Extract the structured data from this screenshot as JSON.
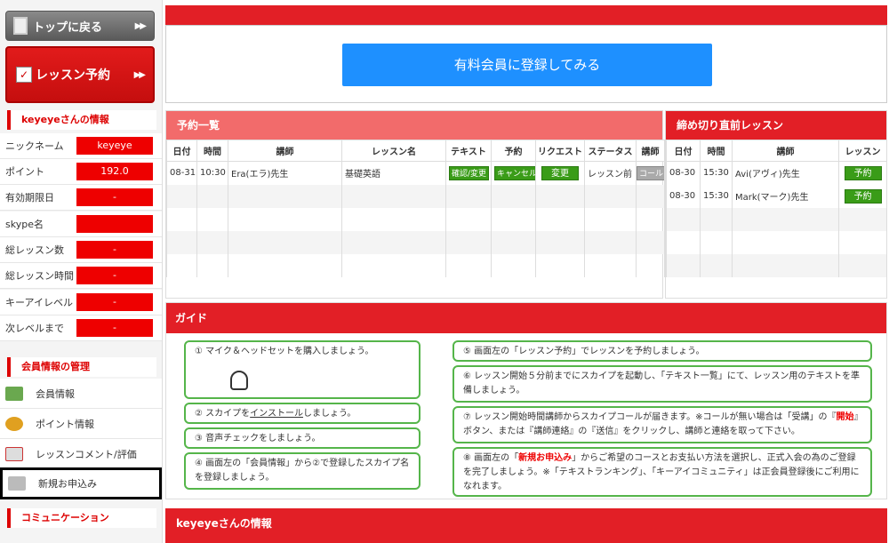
{
  "sidebar": {
    "top_label": "トップに戻る",
    "top_arrow": "▶▶",
    "reserve_label": "レッスン予約",
    "reserve_arrow": "▶▶",
    "info_title": "keyeyeさんの情報",
    "info_rows": [
      {
        "label": "ニックネーム",
        "value": "keyeye"
      },
      {
        "label": "ポイント",
        "value": "192.0"
      },
      {
        "label": "有効期限日",
        "value": "-"
      },
      {
        "label": "skype名",
        "value": ""
      },
      {
        "label": "総レッスン数",
        "value": "-"
      },
      {
        "label": "総レッスン時間",
        "value": "-"
      },
      {
        "label": "キーアイレベル",
        "value": "-"
      },
      {
        "label": "次レベルまで",
        "value": "-"
      }
    ],
    "member_title": "会員情報の管理",
    "member_items": [
      "会員情報",
      "ポイント情報",
      "レッスンコメント/評価",
      "新規お申込み"
    ],
    "comm_title": "コミュニケーション"
  },
  "register_button": "有料会員に登録してみる",
  "reservations": {
    "title": "予約一覧",
    "headers": [
      "日付",
      "時間",
      "講師",
      "レッスン名",
      "テキスト",
      "予約",
      "リクエスト",
      "ステータス",
      "講師"
    ],
    "row": {
      "date": "08-31",
      "time": "10:30",
      "teacher": "Era(エラ)先生",
      "lesson": "基礎英語",
      "text_btn": "確認/変更",
      "cancel_btn": "キャンセル",
      "change_btn": "変更",
      "status": "レッスン前",
      "call_btn": "コール"
    }
  },
  "deadline": {
    "title": "締め切り直前レッスン",
    "headers": [
      "日付",
      "時間",
      "講師",
      "レッスン"
    ],
    "rows": [
      {
        "date": "08-30",
        "time": "15:30",
        "teacher": "Avi(アヴィ)先生",
        "btn": "予約"
      },
      {
        "date": "08-30",
        "time": "15:30",
        "teacher": "Mark(マーク)先生",
        "btn": "予約"
      }
    ]
  },
  "guide": {
    "title": "ガイド",
    "step1": "① マイク＆ヘッドセットを購入しましょう。",
    "step2_pre": "② スカイプを",
    "step2_link": "インストール",
    "step2_post": "しましょう。",
    "step3": "③ 音声チェックをしましょう。",
    "step4": "④ 画面左の「会員情報」から②で登録したスカイプ名を登録しましょう。",
    "step5": "⑤ 画面左の「レッスン予約」でレッスンを予約しましょう。",
    "step6": "⑥ レッスン開始５分前までにスカイプを起動し、「テキスト一覧」にて、レッスン用のテキストを準備しましょう。",
    "step7_pre": "⑦ レッスン開始時間講師からスカイプコールが届きます。※コールが無い場合は「受講」の『",
    "step7_red": "開始",
    "step7_post": "』ボタン、または『講師連絡』の『送信』をクリックし、講師と連絡を取って下さい。",
    "step8_pre": "⑧ 画面左の「",
    "step8_red": "新規お申込み",
    "step8_post": "」からご希望のコースとお支払い方法を選択し、正式入会の為のご登録を完了しましょう。※「テキストランキング」、「キーアイコミュニティ」は正会員登録後にご利用になれます。"
  },
  "footer_title": "keyeyeさんの情報"
}
